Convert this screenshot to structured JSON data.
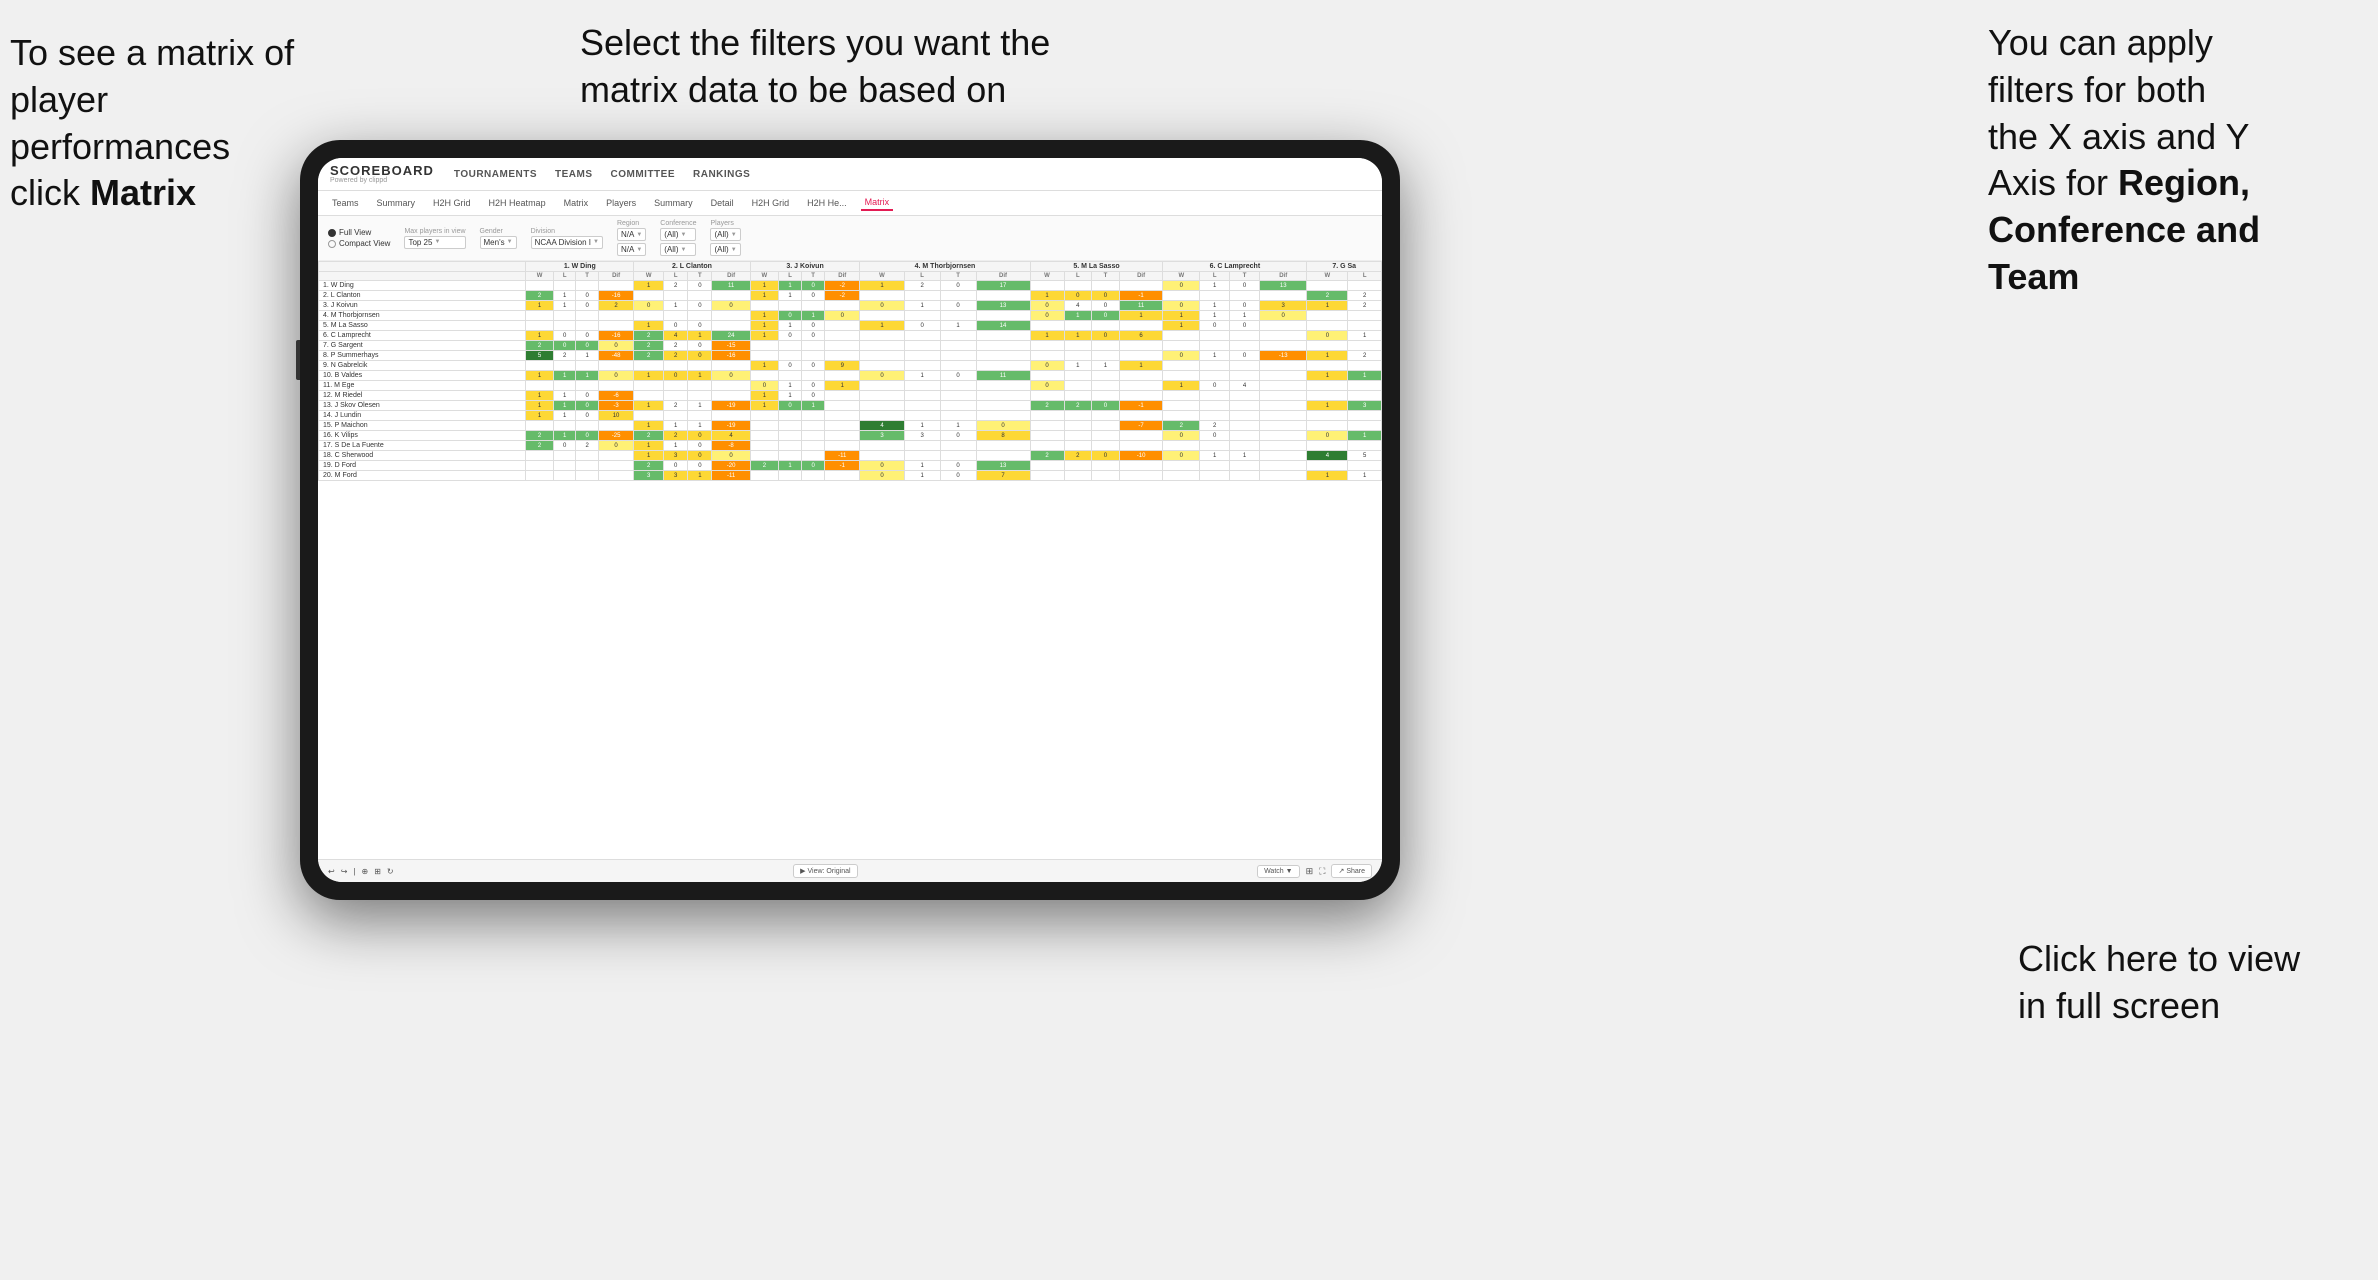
{
  "annotations": {
    "left": {
      "line1": "To see a matrix of",
      "line2": "player performances",
      "line3_normal": "click ",
      "line3_bold": "Matrix"
    },
    "center": {
      "line1": "Select the filters you want the",
      "line2": "matrix data to be based on"
    },
    "right": {
      "line1": "You  can apply",
      "line2": "filters for both",
      "line3": "the X axis and Y",
      "line4_normal": "Axis for ",
      "line4_bold": "Region,",
      "line5_bold": "Conference and",
      "line6_bold": "Team"
    },
    "bottom_right": {
      "line1": "Click here to view",
      "line2": "in full screen"
    }
  },
  "app": {
    "logo": "SCOREBOARD",
    "logo_sub": "Powered by clippd",
    "nav": [
      "TOURNAMENTS",
      "TEAMS",
      "COMMITTEE",
      "RANKINGS"
    ],
    "sub_nav": [
      "Teams",
      "Summary",
      "H2H Grid",
      "H2H Heatmap",
      "Matrix",
      "Players",
      "Summary",
      "Detail",
      "H2H Grid",
      "H2H He...",
      "Matrix"
    ],
    "active_sub_nav": "Matrix",
    "filters": {
      "view_options": [
        "Full View",
        "Compact View"
      ],
      "selected_view": "Full View",
      "max_players_label": "Max players in view",
      "max_players_value": "Top 25",
      "gender_label": "Gender",
      "gender_value": "Men's",
      "division_label": "Division",
      "division_value": "NCAA Division I",
      "region_label": "Region",
      "region_value": "N/A",
      "region_value2": "N/A",
      "conference_label": "Conference",
      "conference_value": "(All)",
      "conference_value2": "(All)",
      "players_label": "Players",
      "players_value": "(All)",
      "players_value2": "(All)"
    },
    "columns": [
      {
        "name": "1. W Ding",
        "subs": [
          "W",
          "L",
          "T",
          "Dif"
        ]
      },
      {
        "name": "2. L Clanton",
        "subs": [
          "W",
          "L",
          "T",
          "Dif"
        ]
      },
      {
        "name": "3. J Koivun",
        "subs": [
          "W",
          "L",
          "T",
          "Dif"
        ]
      },
      {
        "name": "4. M Thorbjornsen",
        "subs": [
          "W",
          "L",
          "T",
          "Dif"
        ]
      },
      {
        "name": "5. M La Sasso",
        "subs": [
          "W",
          "L",
          "T",
          "Dif"
        ]
      },
      {
        "name": "6. C Lamprecht",
        "subs": [
          "W",
          "L",
          "T",
          "Dif"
        ]
      },
      {
        "name": "7. G Sa",
        "subs": [
          "W",
          "L"
        ]
      }
    ],
    "rows": [
      {
        "name": "1. W Ding",
        "cells": [
          [
            "",
            "",
            "",
            ""
          ],
          [
            "1",
            "2",
            "0",
            "11"
          ],
          [
            "1",
            "1",
            "0",
            "-2"
          ],
          [
            "1",
            "2",
            "0",
            "17"
          ],
          [
            "",
            "",
            "",
            ""
          ],
          [
            "0",
            "1",
            "0",
            "13"
          ],
          [
            "",
            "",
            ""
          ]
        ]
      },
      {
        "name": "2. L Clanton",
        "cells": [
          [
            "2",
            "1",
            "0",
            "-16"
          ],
          [
            "",
            "",
            "",
            ""
          ],
          [
            "1",
            "1",
            "0",
            "-2"
          ],
          [
            "",
            "",
            "",
            ""
          ],
          [
            "1",
            "0",
            "0",
            "-1"
          ],
          [
            "",
            "",
            "",
            ""
          ],
          [
            "2",
            "2"
          ]
        ]
      },
      {
        "name": "3. J Koivun",
        "cells": [
          [
            "1",
            "1",
            "0",
            "2"
          ],
          [
            "0",
            "1",
            "0",
            "0"
          ],
          [
            "",
            "",
            "",
            ""
          ],
          [
            "0",
            "1",
            "0",
            "13"
          ],
          [
            "0",
            "4",
            "0",
            "11"
          ],
          [
            "0",
            "1",
            "0",
            "3"
          ],
          [
            "1",
            "2"
          ]
        ]
      },
      {
        "name": "4. M Thorbjornsen",
        "cells": [
          [
            "",
            "",
            "",
            ""
          ],
          [
            "",
            "",
            "",
            ""
          ],
          [
            "1",
            "0",
            "1",
            "0"
          ],
          [
            "",
            "",
            "",
            ""
          ],
          [
            "0",
            "1",
            "0",
            "1"
          ],
          [
            "1",
            "1",
            "1",
            "0"
          ],
          [
            "",
            "",
            ""
          ]
        ]
      },
      {
        "name": "5. M La Sasso",
        "cells": [
          [
            "",
            "",
            "",
            ""
          ],
          [
            "1",
            "0",
            "0",
            ""
          ],
          [
            "1",
            "1",
            "0",
            ""
          ],
          [
            "1",
            "0",
            "1",
            "14"
          ],
          [
            "",
            "",
            "",
            ""
          ],
          [
            "1",
            "0",
            "0",
            ""
          ],
          [
            "",
            "",
            ""
          ]
        ]
      },
      {
        "name": "6. C Lamprecht",
        "cells": [
          [
            "1",
            "0",
            "0",
            "-16"
          ],
          [
            "2",
            "4",
            "1",
            "24"
          ],
          [
            "1",
            "0",
            "0",
            ""
          ],
          [
            "",
            "",
            "",
            ""
          ],
          [
            "1",
            "1",
            "0",
            "6"
          ],
          [
            "",
            "",
            "",
            ""
          ],
          [
            "0",
            "1"
          ]
        ]
      },
      {
        "name": "7. G Sargent",
        "cells": [
          [
            "2",
            "0",
            "0",
            "0"
          ],
          [
            "2",
            "2",
            "0",
            "-15"
          ],
          [
            "",
            "",
            "",
            ""
          ],
          [
            "",
            "",
            "",
            ""
          ],
          [
            "",
            "",
            "",
            ""
          ],
          [
            "",
            "",
            "",
            ""
          ],
          [
            "",
            "",
            ""
          ]
        ]
      },
      {
        "name": "8. P Summerhays",
        "cells": [
          [
            "5",
            "2",
            "1",
            "-48"
          ],
          [
            "2",
            "2",
            "0",
            "-16"
          ],
          [
            "",
            "",
            "",
            ""
          ],
          [
            "",
            "",
            "",
            ""
          ],
          [
            "",
            "",
            "",
            ""
          ],
          [
            "0",
            "1",
            "0",
            "-13"
          ],
          [
            "1",
            "2"
          ]
        ]
      },
      {
        "name": "9. N Gabrelcik",
        "cells": [
          [
            "",
            "",
            "",
            ""
          ],
          [
            "",
            "",
            "",
            ""
          ],
          [
            "1",
            "0",
            "0",
            "9"
          ],
          [
            "",
            "",
            "",
            ""
          ],
          [
            "0",
            "1",
            "1",
            "1"
          ],
          [
            "",
            "",
            "",
            ""
          ],
          [
            "",
            "",
            ""
          ]
        ]
      },
      {
        "name": "10. B Valdes",
        "cells": [
          [
            "1",
            "1",
            "1",
            "0"
          ],
          [
            "1",
            "0",
            "1",
            "0"
          ],
          [
            "",
            "",
            "",
            ""
          ],
          [
            "0",
            "1",
            "0",
            "11"
          ],
          [
            "",
            "",
            "",
            ""
          ],
          [
            "",
            "",
            "",
            ""
          ],
          [
            "1",
            "1"
          ]
        ]
      },
      {
        "name": "11. M Ege",
        "cells": [
          [
            "",
            "",
            "",
            ""
          ],
          [
            "",
            "",
            "",
            ""
          ],
          [
            "0",
            "1",
            "0",
            "1"
          ],
          [
            "",
            "",
            "",
            ""
          ],
          [
            "0",
            "",
            "",
            ""
          ],
          [
            "1",
            "0",
            "4",
            ""
          ],
          [
            "",
            "",
            ""
          ]
        ]
      },
      {
        "name": "12. M Riedel",
        "cells": [
          [
            "1",
            "1",
            "0",
            "-6"
          ],
          [
            "",
            "",
            "",
            ""
          ],
          [
            "1",
            "1",
            "0",
            ""
          ],
          [
            "",
            "",
            "",
            ""
          ],
          [
            "",
            "",
            "",
            ""
          ],
          [
            "",
            "",
            "",
            ""
          ],
          [
            "",
            "",
            ""
          ]
        ]
      },
      {
        "name": "13. J Skov Olesen",
        "cells": [
          [
            "1",
            "1",
            "0",
            "-3"
          ],
          [
            "1",
            "2",
            "1",
            "-19"
          ],
          [
            "1",
            "0",
            "1",
            ""
          ],
          [
            "",
            "",
            "",
            ""
          ],
          [
            "2",
            "2",
            "0",
            "-1"
          ],
          [
            "",
            "",
            "",
            ""
          ],
          [
            "1",
            "3"
          ]
        ]
      },
      {
        "name": "14. J Lundin",
        "cells": [
          [
            "1",
            "1",
            "0",
            "10"
          ],
          [
            "",
            "",
            "",
            ""
          ],
          [
            "",
            "",
            "",
            ""
          ],
          [
            "",
            "",
            "",
            ""
          ],
          [
            "",
            "",
            "",
            ""
          ],
          [
            "",
            "",
            "",
            ""
          ],
          [
            "",
            "",
            ""
          ]
        ]
      },
      {
        "name": "15. P Maichon",
        "cells": [
          [
            "",
            "",
            "",
            ""
          ],
          [
            "1",
            "1",
            "1",
            "-19"
          ],
          [
            "",
            "",
            "",
            ""
          ],
          [
            "4",
            "1",
            "1",
            "0"
          ],
          [
            "",
            "",
            "",
            "-7"
          ],
          [
            "2",
            "2"
          ]
        ]
      },
      {
        "name": "16. K Vilips",
        "cells": [
          [
            "2",
            "1",
            "0",
            "-25"
          ],
          [
            "2",
            "2",
            "0",
            "4"
          ],
          [
            "",
            "",
            "",
            ""
          ],
          [
            "3",
            "3",
            "0",
            "8"
          ],
          [
            "",
            "",
            "",
            ""
          ],
          [
            "0",
            "0",
            "",
            ""
          ],
          [
            "0",
            "1"
          ]
        ]
      },
      {
        "name": "17. S De La Fuente",
        "cells": [
          [
            "2",
            "0",
            "2",
            "0"
          ],
          [
            "1",
            "1",
            "0",
            "-8"
          ],
          [
            "",
            "",
            "",
            ""
          ],
          [
            "",
            "",
            "",
            ""
          ],
          [
            "",
            "",
            "",
            ""
          ],
          [
            "",
            "",
            "",
            ""
          ],
          [
            "",
            "",
            ""
          ]
        ]
      },
      {
        "name": "18. C Sherwood",
        "cells": [
          [
            "",
            "",
            "",
            ""
          ],
          [
            "1",
            "3",
            "0",
            "0"
          ],
          [
            "",
            "",
            "",
            "-11"
          ],
          [
            "",
            "",
            "",
            ""
          ],
          [
            "2",
            "2",
            "0",
            "-10"
          ],
          [
            "0",
            "1",
            "1",
            ""
          ],
          [
            "4",
            "5"
          ]
        ]
      },
      {
        "name": "19. D Ford",
        "cells": [
          [
            "",
            "",
            "",
            ""
          ],
          [
            "2",
            "0",
            "0",
            "-20"
          ],
          [
            "2",
            "1",
            "0",
            "-1"
          ],
          [
            "0",
            "1",
            "0",
            "13"
          ],
          [
            "",
            "",
            "",
            ""
          ],
          [
            "",
            "",
            "",
            ""
          ],
          [
            "",
            "",
            ""
          ]
        ]
      },
      {
        "name": "20. M Ford",
        "cells": [
          [
            "",
            "",
            "",
            ""
          ],
          [
            "3",
            "3",
            "1",
            "-11"
          ],
          [
            "",
            "",
            "",
            ""
          ],
          [
            "0",
            "1",
            "0",
            "7"
          ],
          [
            "",
            "",
            "",
            ""
          ],
          [
            "",
            "",
            "",
            ""
          ],
          [
            "1",
            "1"
          ]
        ]
      }
    ],
    "footer": {
      "view_label": "View: Original",
      "watch_label": "Watch",
      "share_label": "Share"
    }
  }
}
